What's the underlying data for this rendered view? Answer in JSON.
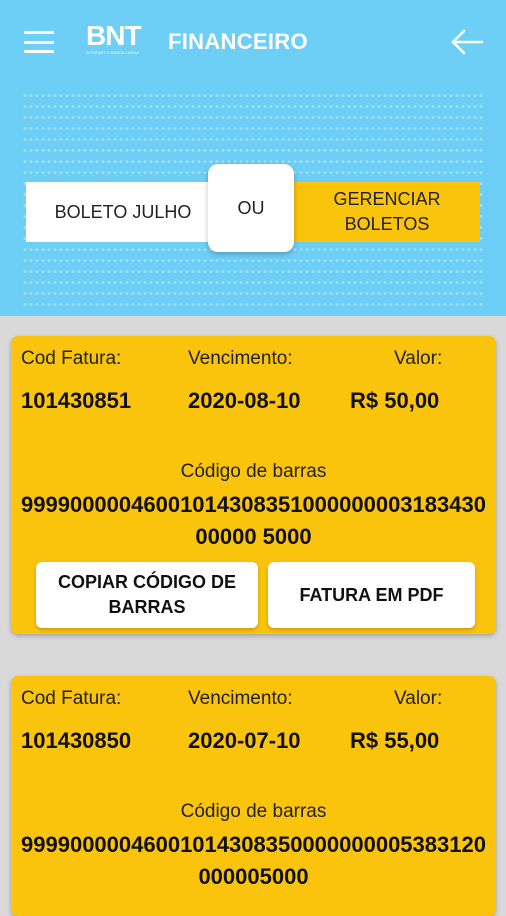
{
  "header": {
    "logo": "BNT",
    "logo_sub": "INTERNET E BANDA LARGA",
    "title": "FINANCEIRO"
  },
  "toggle": {
    "left_label": "BOLETO JULHO",
    "middle_label": "OU",
    "right_label": "GERENCIAR BOLETOS"
  },
  "labels": {
    "cod_fatura": "Cod Fatura:",
    "vencimento": "Vencimento:",
    "valor": "Valor:",
    "codigo_barras": "Código de barras"
  },
  "invoices": [
    {
      "cod_fatura": "101430851",
      "vencimento": "2020-08-10",
      "valor": "R$ 50,00",
      "codigo_barras": "9999000004600101430835100000000318343000000 5000",
      "copy_button": "COPIAR CÓDIGO DE BARRAS",
      "pdf_button": "FATURA EM PDF"
    },
    {
      "cod_fatura": "101430850",
      "vencimento": "2020-07-10",
      "valor": "R$ 55,00",
      "codigo_barras": "99990000046001014308350000000005383120000005000"
    }
  ],
  "colors": {
    "header_bg": "#6dcff6",
    "card_bg": "#fbc40c",
    "page_bg": "#d9d9d9"
  }
}
